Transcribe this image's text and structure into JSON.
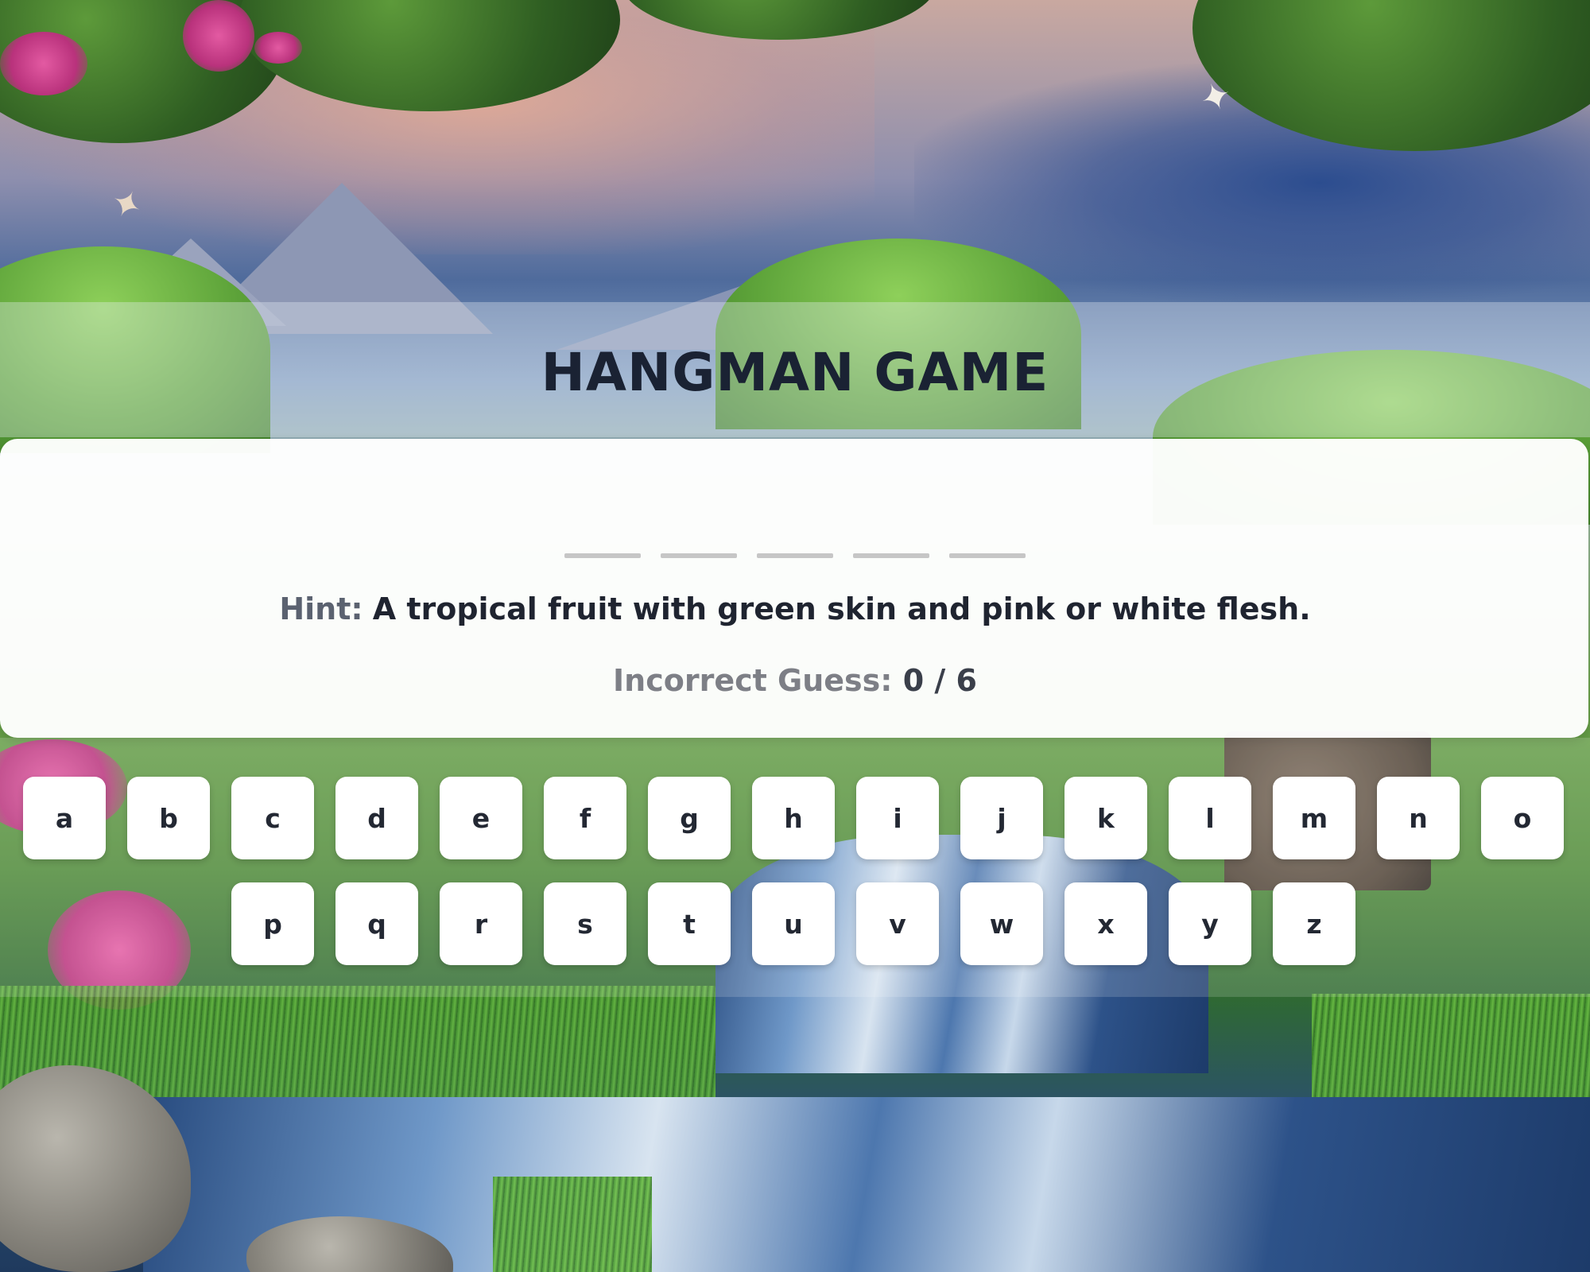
{
  "title": "HANGMAN GAME",
  "word": {
    "blank_count": 5
  },
  "hint": {
    "label": "Hint:",
    "text": "A tropical fruit with green skin and pink or white flesh."
  },
  "incorrect": {
    "label": "Incorrect Guess:",
    "value": "0 / 6"
  },
  "keyboard": {
    "row1": [
      "a",
      "b",
      "c",
      "d",
      "e",
      "f",
      "g",
      "h",
      "i",
      "j",
      "k",
      "l",
      "m",
      "n",
      "o"
    ],
    "row2": [
      "p",
      "q",
      "r",
      "s",
      "t",
      "u",
      "v",
      "w",
      "x",
      "y",
      "z"
    ]
  },
  "colors": {
    "title": "#1a2233",
    "card": "#ffffff",
    "blank": "#c6c6c6",
    "key": "#ffffff"
  }
}
